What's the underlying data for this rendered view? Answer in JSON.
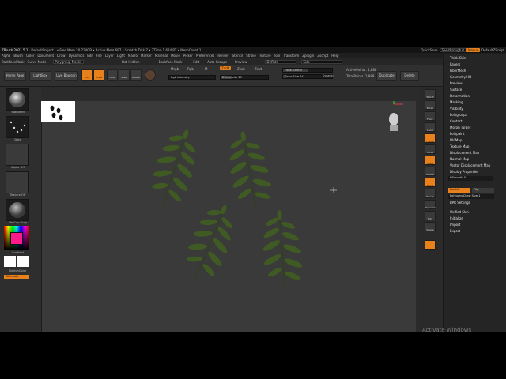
{
  "titlebar": {
    "app_name": "ZBrush 2021.5.1",
    "project": "DefaultProject",
    "mem": "• Free Mem 20.734GB • Active Mem 697 • Scratch Disk 7 • ZTime 1.624 RT • MeshCount 1",
    "quicksave": "QuickSave",
    "seethrough": "See-through 0",
    "menus_label": "Menus",
    "script": "DefaultZScript"
  },
  "menubar": {
    "items": [
      "Alpha",
      "Brush",
      "Color",
      "Document",
      "Draw",
      "Dynamics",
      "Edit",
      "File",
      "Layer",
      "Light",
      "Macro",
      "Marker",
      "Material",
      "Movie",
      "Picker",
      "Preferences",
      "Render",
      "Stencil",
      "Stroke",
      "Texture",
      "Tool",
      "Transform",
      "Zplugin",
      "Zscript",
      "Help"
    ]
  },
  "stripbar": {
    "items": [
      "BackfaceMask",
      "Curve Mode",
      "Polygroup Masks",
      "Dot Hidden",
      "Backface Mask",
      "Edit",
      "Auto Groups",
      "Preview",
      "Deflate",
      "Size"
    ]
  },
  "toolbar": {
    "home": "Home Page",
    "lightbox": "LightBox",
    "live_boolean": "Live Boolean",
    "edit": "Edit",
    "draw": "Draw",
    "move": "Move",
    "scale": "Scale",
    "rotate": "Rotate",
    "mrgb": "Mrgb",
    "rgb": "Rgb",
    "m": "M",
    "zadd": "Zadd",
    "zsub": "Zsub",
    "zcut": "Zcut",
    "rgb_intensity": "Rgb Intensity",
    "z_intensity": "Z Intensity 25",
    "focal_shift": "Focal Shift 0",
    "draw_size": "Draw Size 64",
    "dynamic": "Dynamic",
    "active_points": "ActivePoints: 1,888",
    "total_points": "TotalPoints: 1,888",
    "duplicate": "Duplicate",
    "delete": "Delete"
  },
  "leftshelf": {
    "brush": "Standard",
    "stroke": "Dots",
    "alpha": "Alpha Off",
    "texture": "Texture Off",
    "material": "MatCap Gray",
    "gradient": "Gradient",
    "switch_color": "SwitchColor",
    "alternate": "Alternate"
  },
  "rightshelf": {
    "buttons": [
      "SPix 3",
      "Persp",
      "Floor",
      "Local",
      "Frame",
      "Move",
      "Scale",
      "Rotate",
      "PolyF",
      "Transp",
      "Dynamic",
      "Solo",
      "Xpose"
    ]
  },
  "tray": {
    "items": [
      "Thick Skin",
      "Layers",
      "FiberMesh",
      "Geometry HD",
      "Preview",
      "Surface",
      "Deformation",
      "Masking",
      "Visibility",
      "Polygroups",
      "Contact",
      "Morph Target",
      "Polypaint",
      "UV Map",
      "Texture Map",
      "Displacement Map",
      "Normal Map",
      "Vector Displacement Map",
      "Display Properties"
    ],
    "dsmooth": "DSmooth 0",
    "double": "Double",
    "flip": "Flip",
    "bpr": "BPR Settings",
    "polygroups_draw": "Polygons Draw Size 1",
    "bottom_items": [
      "Unified Skin",
      "Initialize",
      "Import",
      "Export"
    ]
  },
  "os": {
    "activate": "Activate Windows"
  },
  "colors": {
    "accent": "#e8801c",
    "canvas": "#3a3a3a",
    "leaf": "#3f5a22"
  }
}
